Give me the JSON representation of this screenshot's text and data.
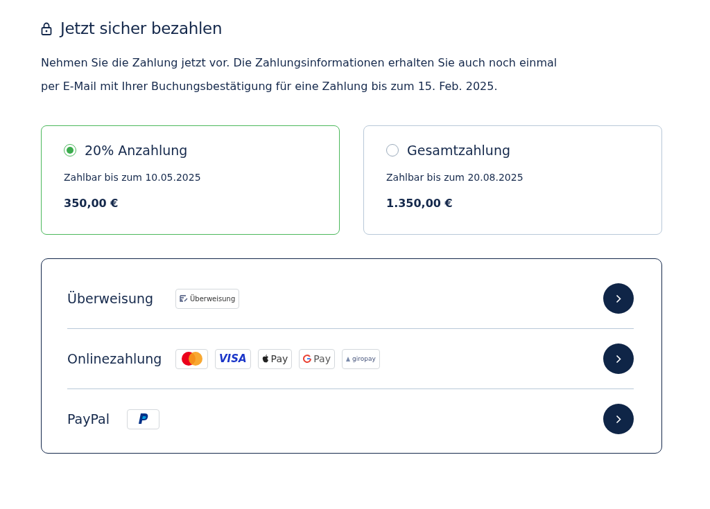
{
  "title": "Jetzt sicher bezahlen",
  "intro": "Nehmen Sie die Zahlung jetzt vor. Die Zahlungsinformationen erhalten Sie auch noch einmal per E-Mail mit Ihrer Buchungsbestätigung für eine Zahlung bis zum 15. Feb. 2025.",
  "options": [
    {
      "label": "20% Anzahlung",
      "due": "Zahlbar bis zum 10.05.2025",
      "amount": "350,00 €",
      "selected": true
    },
    {
      "label": "Gesamtzahlung",
      "due": "Zahlbar bis zum 20.08.2025",
      "amount": "1.350,00 €",
      "selected": false
    }
  ],
  "methods": [
    {
      "label": "Überweisung",
      "badges": [
        {
          "kind": "transfer",
          "text": "Überweisung"
        }
      ]
    },
    {
      "label": "Onlinezahlung",
      "badges": [
        {
          "kind": "mastercard"
        },
        {
          "kind": "visa",
          "text": "VISA"
        },
        {
          "kind": "applepay",
          "text": "Pay"
        },
        {
          "kind": "googlepay",
          "text": "Pay"
        },
        {
          "kind": "giropay",
          "text": "giropay"
        }
      ]
    },
    {
      "label": "PayPal",
      "badges": [
        {
          "kind": "paypal"
        }
      ]
    }
  ]
}
